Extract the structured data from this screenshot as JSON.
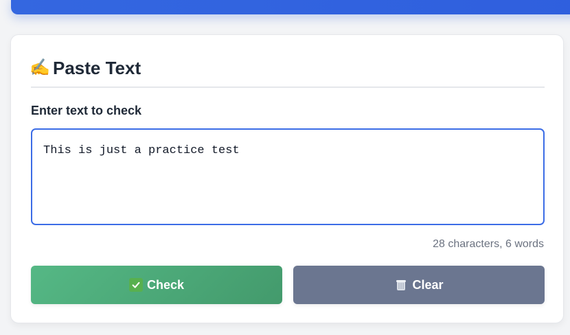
{
  "card": {
    "title": "Paste Text",
    "title_icon": "writing-hand-icon"
  },
  "form": {
    "label": "Enter text to check",
    "value": "This is just a practice test",
    "counter": "28 characters, 6 words"
  },
  "buttons": {
    "check_label": "Check",
    "clear_label": "Clear",
    "check_icon": "check-mark-button-icon",
    "clear_icon": "trash-can-icon"
  },
  "colors": {
    "banner": "#3467e0",
    "input_border": "#3b6ce6",
    "check_button": "#4caa78",
    "clear_button": "#6b7690",
    "text": "#1f2937",
    "muted_text": "#6b7280"
  }
}
